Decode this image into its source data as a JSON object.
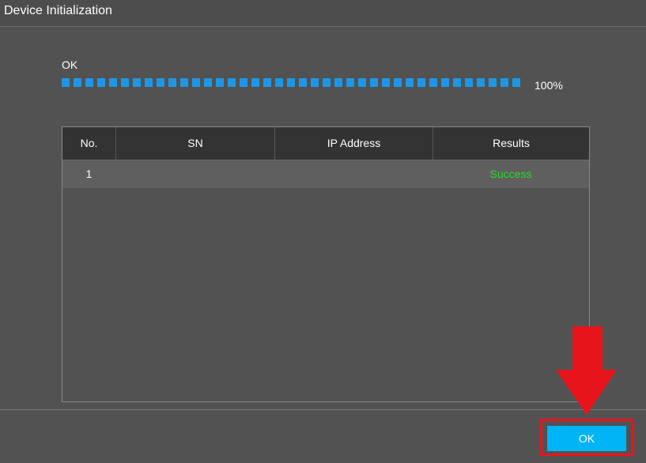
{
  "window": {
    "title": "Device Initialization"
  },
  "progress": {
    "status": "OK",
    "percent_label": "100%",
    "value": 1.0
  },
  "table": {
    "columns": [
      "No.",
      "SN",
      "IP Address",
      "Results"
    ],
    "rows": [
      {
        "no": "1",
        "sn": "",
        "ip": "",
        "result": "Success"
      }
    ]
  },
  "footer": {
    "ok_label": "OK"
  },
  "colors": {
    "background": "#525252",
    "progress": "#1e96e6",
    "success": "#22e022",
    "button": "#00b4f5",
    "annotation": "#e8141c"
  },
  "icons": {
    "annotation_arrow": "arrow-down-icon"
  }
}
